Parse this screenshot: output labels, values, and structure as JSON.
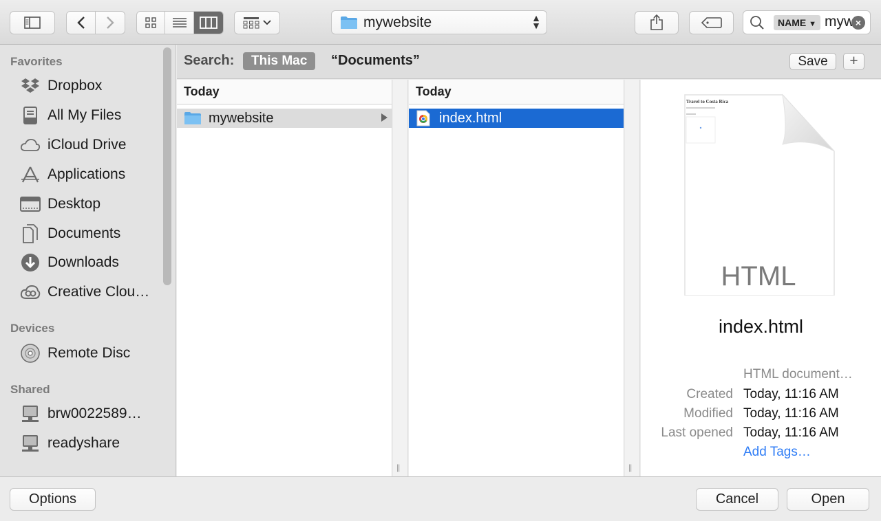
{
  "toolbar": {
    "path_popup": "mywebsite",
    "search_token": "NAME",
    "search_text": "myw"
  },
  "sidebar": {
    "sections": [
      {
        "title": "Favorites"
      },
      {
        "title": "Devices"
      },
      {
        "title": "Shared"
      }
    ],
    "favorites": [
      "Dropbox",
      "All My Files",
      "iCloud Drive",
      "Applications",
      "Desktop",
      "Documents",
      "Downloads",
      "Creative Clou…"
    ],
    "devices": [
      "Remote Disc"
    ],
    "shared": [
      "brw0022589…",
      "readyshare"
    ]
  },
  "scope": {
    "label": "Search:",
    "this_mac": "This Mac",
    "documents": "“Documents”",
    "save": "Save",
    "plus": "+"
  },
  "columns": [
    {
      "header": "Today",
      "item": "mywebsite"
    },
    {
      "header": "Today",
      "item": "index.html"
    }
  ],
  "preview": {
    "thumb_title": "Travel to Costa Rica",
    "thumb_type": "HTML",
    "file_name": "index.html",
    "kind": "HTML document…",
    "created_label": "Created",
    "created_value": "Today, 11:16 AM",
    "modified_label": "Modified",
    "modified_value": "Today, 11:16 AM",
    "opened_label": "Last opened",
    "opened_value": "Today, 11:16 AM",
    "add_tags": "Add Tags…"
  },
  "bottom": {
    "options": "Options",
    "cancel": "Cancel",
    "open": "Open"
  }
}
